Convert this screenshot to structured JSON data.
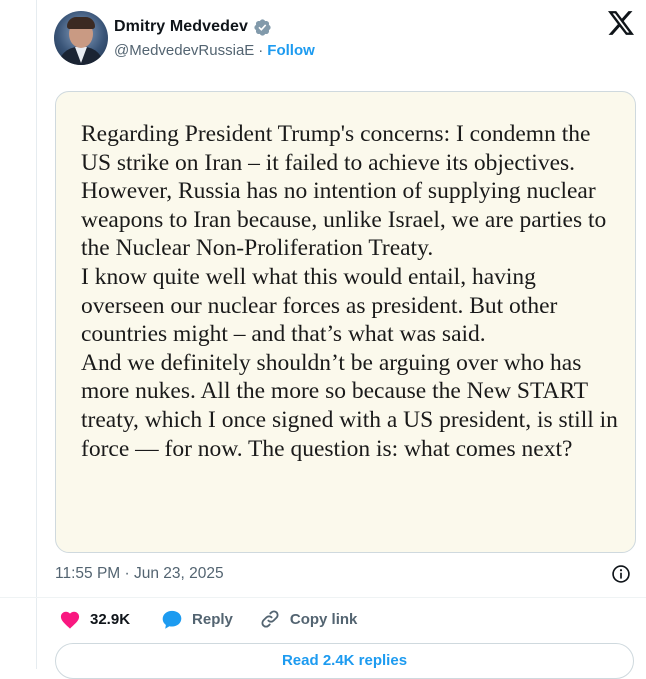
{
  "author": {
    "name": "Dmitry Medvedev",
    "handle": "@MedvedevRussiaE",
    "separator": "·",
    "follow_label": "Follow"
  },
  "document": {
    "paragraphs": [
      "Regarding President Trump's concerns: I condemn the US strike on Iran – it failed to achieve its objectives. However, Russia has no intention of supplying nuclear weapons to Iran because, unlike Israel, we are parties to the Nuclear Non-Proliferation Treaty.",
      "I know quite well what this would entail, having overseen our nuclear forces as president. But other countries might – and that’s what was said.",
      "And we definitely shouldn’t be arguing over who has more nukes. All the more so because the New START treaty, which I once signed with a US president, is still in force — for now. The question is: what comes next?"
    ]
  },
  "timestamp": "11:55 PM · Jun 23, 2025",
  "actions": {
    "like_count": "32.9K",
    "reply_label": "Reply",
    "copy_link_label": "Copy link"
  },
  "read_replies_label": "Read 2.4K replies",
  "colors": {
    "accent": "#1d9bf0",
    "like": "#f91880",
    "secondary_text": "#536471",
    "document_bg": "#fbf9ec"
  },
  "icons": [
    "verified-badge-icon",
    "x-logo-icon",
    "info-icon",
    "heart-icon",
    "reply-bubble-icon",
    "link-icon"
  ]
}
